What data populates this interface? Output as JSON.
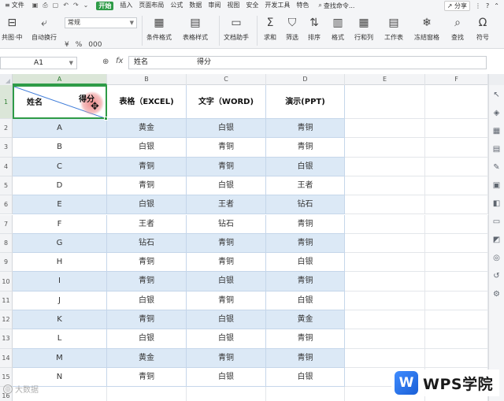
{
  "menubar": {
    "file": "文件",
    "start": "开始",
    "tabs": [
      "插入",
      "页面布局",
      "公式",
      "数据",
      "审阅",
      "视图",
      "安全",
      "开发工具",
      "特色"
    ],
    "search": "查找命令...",
    "share": "分享"
  },
  "ribbon": {
    "font_value": "常规",
    "numfmt": [
      "¥",
      "%",
      "000"
    ],
    "groups": [
      {
        "label": "共图·中",
        "icon": "⊟"
      },
      {
        "label": "自动换行",
        "icon": "⤶"
      },
      {
        "label": "条件格式",
        "icon": "▦"
      },
      {
        "label": "表格样式",
        "icon": "▤"
      },
      {
        "label": "文档助手",
        "icon": "▭"
      },
      {
        "label": "求和",
        "icon": "Σ"
      },
      {
        "label": "筛选",
        "icon": "⛉"
      },
      {
        "label": "排序",
        "icon": "⇅"
      },
      {
        "label": "格式",
        "icon": "▥"
      },
      {
        "label": "行和列",
        "icon": "▦"
      },
      {
        "label": "工作表",
        "icon": "▤"
      },
      {
        "label": "冻结窗格",
        "icon": "❄"
      },
      {
        "label": "查找",
        "icon": "⌕"
      },
      {
        "label": "符号",
        "icon": "Ω"
      }
    ]
  },
  "formula_bar": {
    "name_box": "A1",
    "fx": "fx",
    "content_a": "姓名",
    "content_b": "得分"
  },
  "sheet": {
    "columns": [
      "A",
      "B",
      "C",
      "D",
      "E",
      "F"
    ],
    "selected_column": "A",
    "rows": [
      "1",
      "2",
      "3",
      "4",
      "5",
      "6",
      "7",
      "8",
      "9",
      "10",
      "11",
      "12",
      "13",
      "14",
      "15",
      "16"
    ],
    "header_a_left": "姓名",
    "header_a_right": "得分",
    "headers": [
      "表格（EXCEL)",
      "文字（WORD)",
      "演示(PPT)"
    ],
    "data": [
      [
        "A",
        "黄金",
        "白银",
        "青铜"
      ],
      [
        "B",
        "白银",
        "青铜",
        "青铜"
      ],
      [
        "C",
        "青铜",
        "青铜",
        "白银"
      ],
      [
        "D",
        "青铜",
        "白银",
        "王者"
      ],
      [
        "E",
        "白银",
        "王者",
        "钻石"
      ],
      [
        "F",
        "王者",
        "钻石",
        "青铜"
      ],
      [
        "G",
        "钻石",
        "青铜",
        "青铜"
      ],
      [
        "H",
        "青铜",
        "青铜",
        "白银"
      ],
      [
        "I",
        "青铜",
        "白银",
        "青铜"
      ],
      [
        "J",
        "白银",
        "青铜",
        "白银"
      ],
      [
        "K",
        "青铜",
        "白银",
        "黄金"
      ],
      [
        "L",
        "白银",
        "白银",
        "青铜"
      ],
      [
        "M",
        "黄金",
        "青铜",
        "青铜"
      ],
      [
        "N",
        "青铜",
        "白银",
        "白银"
      ]
    ]
  },
  "overlay": {
    "logo_letter": "W",
    "logo_text": "WPS学院",
    "watermark": "大数据"
  },
  "colors": {
    "accent": "#2e9b47",
    "band": "#dce9f6",
    "grid_line": "#c5d6ea"
  }
}
